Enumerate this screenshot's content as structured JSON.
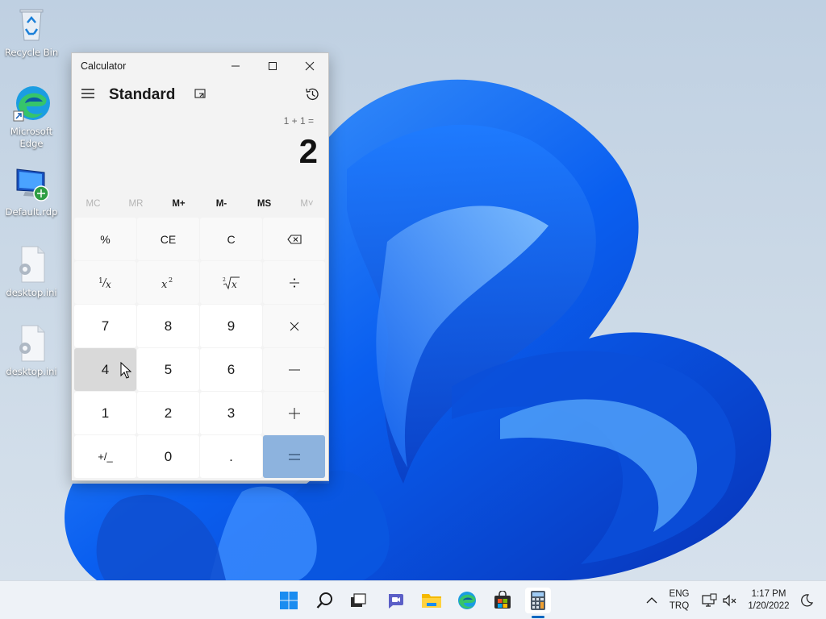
{
  "desktop": {
    "icons": [
      {
        "label": "Recycle Bin",
        "icon": "recycle-bin-icon"
      },
      {
        "label": "Microsoft Edge",
        "icon": "edge-icon"
      },
      {
        "label": "Default.rdp",
        "icon": "remote-desktop-icon"
      },
      {
        "label": "desktop.ini",
        "icon": "settings-file-icon"
      },
      {
        "label": "desktop.ini",
        "icon": "settings-file-icon"
      }
    ]
  },
  "calculator": {
    "window_title": "Calculator",
    "mode": "Standard",
    "expression": "1 + 1 =",
    "result": "2",
    "memory": [
      "MC",
      "MR",
      "M+",
      "M-",
      "MS",
      "M˅"
    ],
    "keys": {
      "percent": "%",
      "clear_entry": "CE",
      "clear": "C",
      "seven": "7",
      "eight": "8",
      "nine": "9",
      "four": "4",
      "five": "5",
      "six": "6",
      "one": "1",
      "two": "2",
      "three": "3",
      "zero": "0",
      "decimal": ".",
      "negate": "+/_"
    },
    "accent_color": "#8db3de"
  },
  "taskbar": {
    "language": "ENG",
    "layout": "TRQ",
    "time": "1:17 PM",
    "date": "1/20/2022",
    "apps": [
      "start-icon",
      "search-icon",
      "task-view-icon",
      "chat-icon",
      "file-explorer-icon",
      "edge-icon",
      "store-icon",
      "calculator-icon"
    ]
  }
}
